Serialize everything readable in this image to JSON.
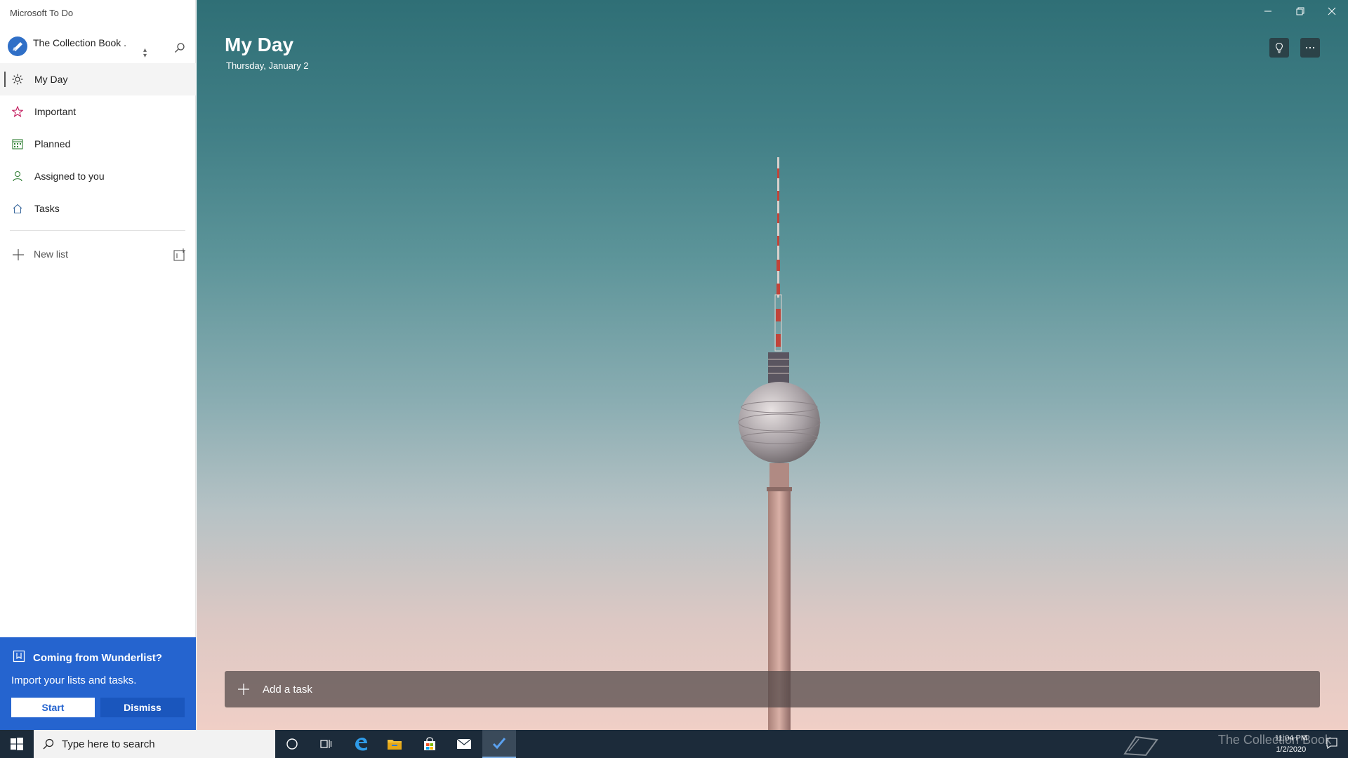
{
  "app": {
    "title": "Microsoft To Do"
  },
  "account": {
    "name": "The Collection Book ."
  },
  "nav": {
    "items": [
      {
        "label": "My Day",
        "icon": "sun-icon",
        "active": true
      },
      {
        "label": "Important",
        "icon": "star-icon"
      },
      {
        "label": "Planned",
        "icon": "calendar-icon"
      },
      {
        "label": "Assigned to you",
        "icon": "person-icon"
      },
      {
        "label": "Tasks",
        "icon": "home-icon"
      }
    ],
    "new_list_label": "New list"
  },
  "banner": {
    "title": "Coming from Wunderlist?",
    "text": "Import your lists and tasks.",
    "start_label": "Start",
    "dismiss_label": "Dismiss",
    "color": "#2564cf"
  },
  "main": {
    "title": "My Day",
    "date": "Thursday, January 2",
    "add_task_label": "Add a task"
  },
  "taskbar": {
    "search_placeholder": "Type here to search",
    "time": "11:04 PM",
    "date": "1/2/2020",
    "watermark": "The Collection Book"
  }
}
